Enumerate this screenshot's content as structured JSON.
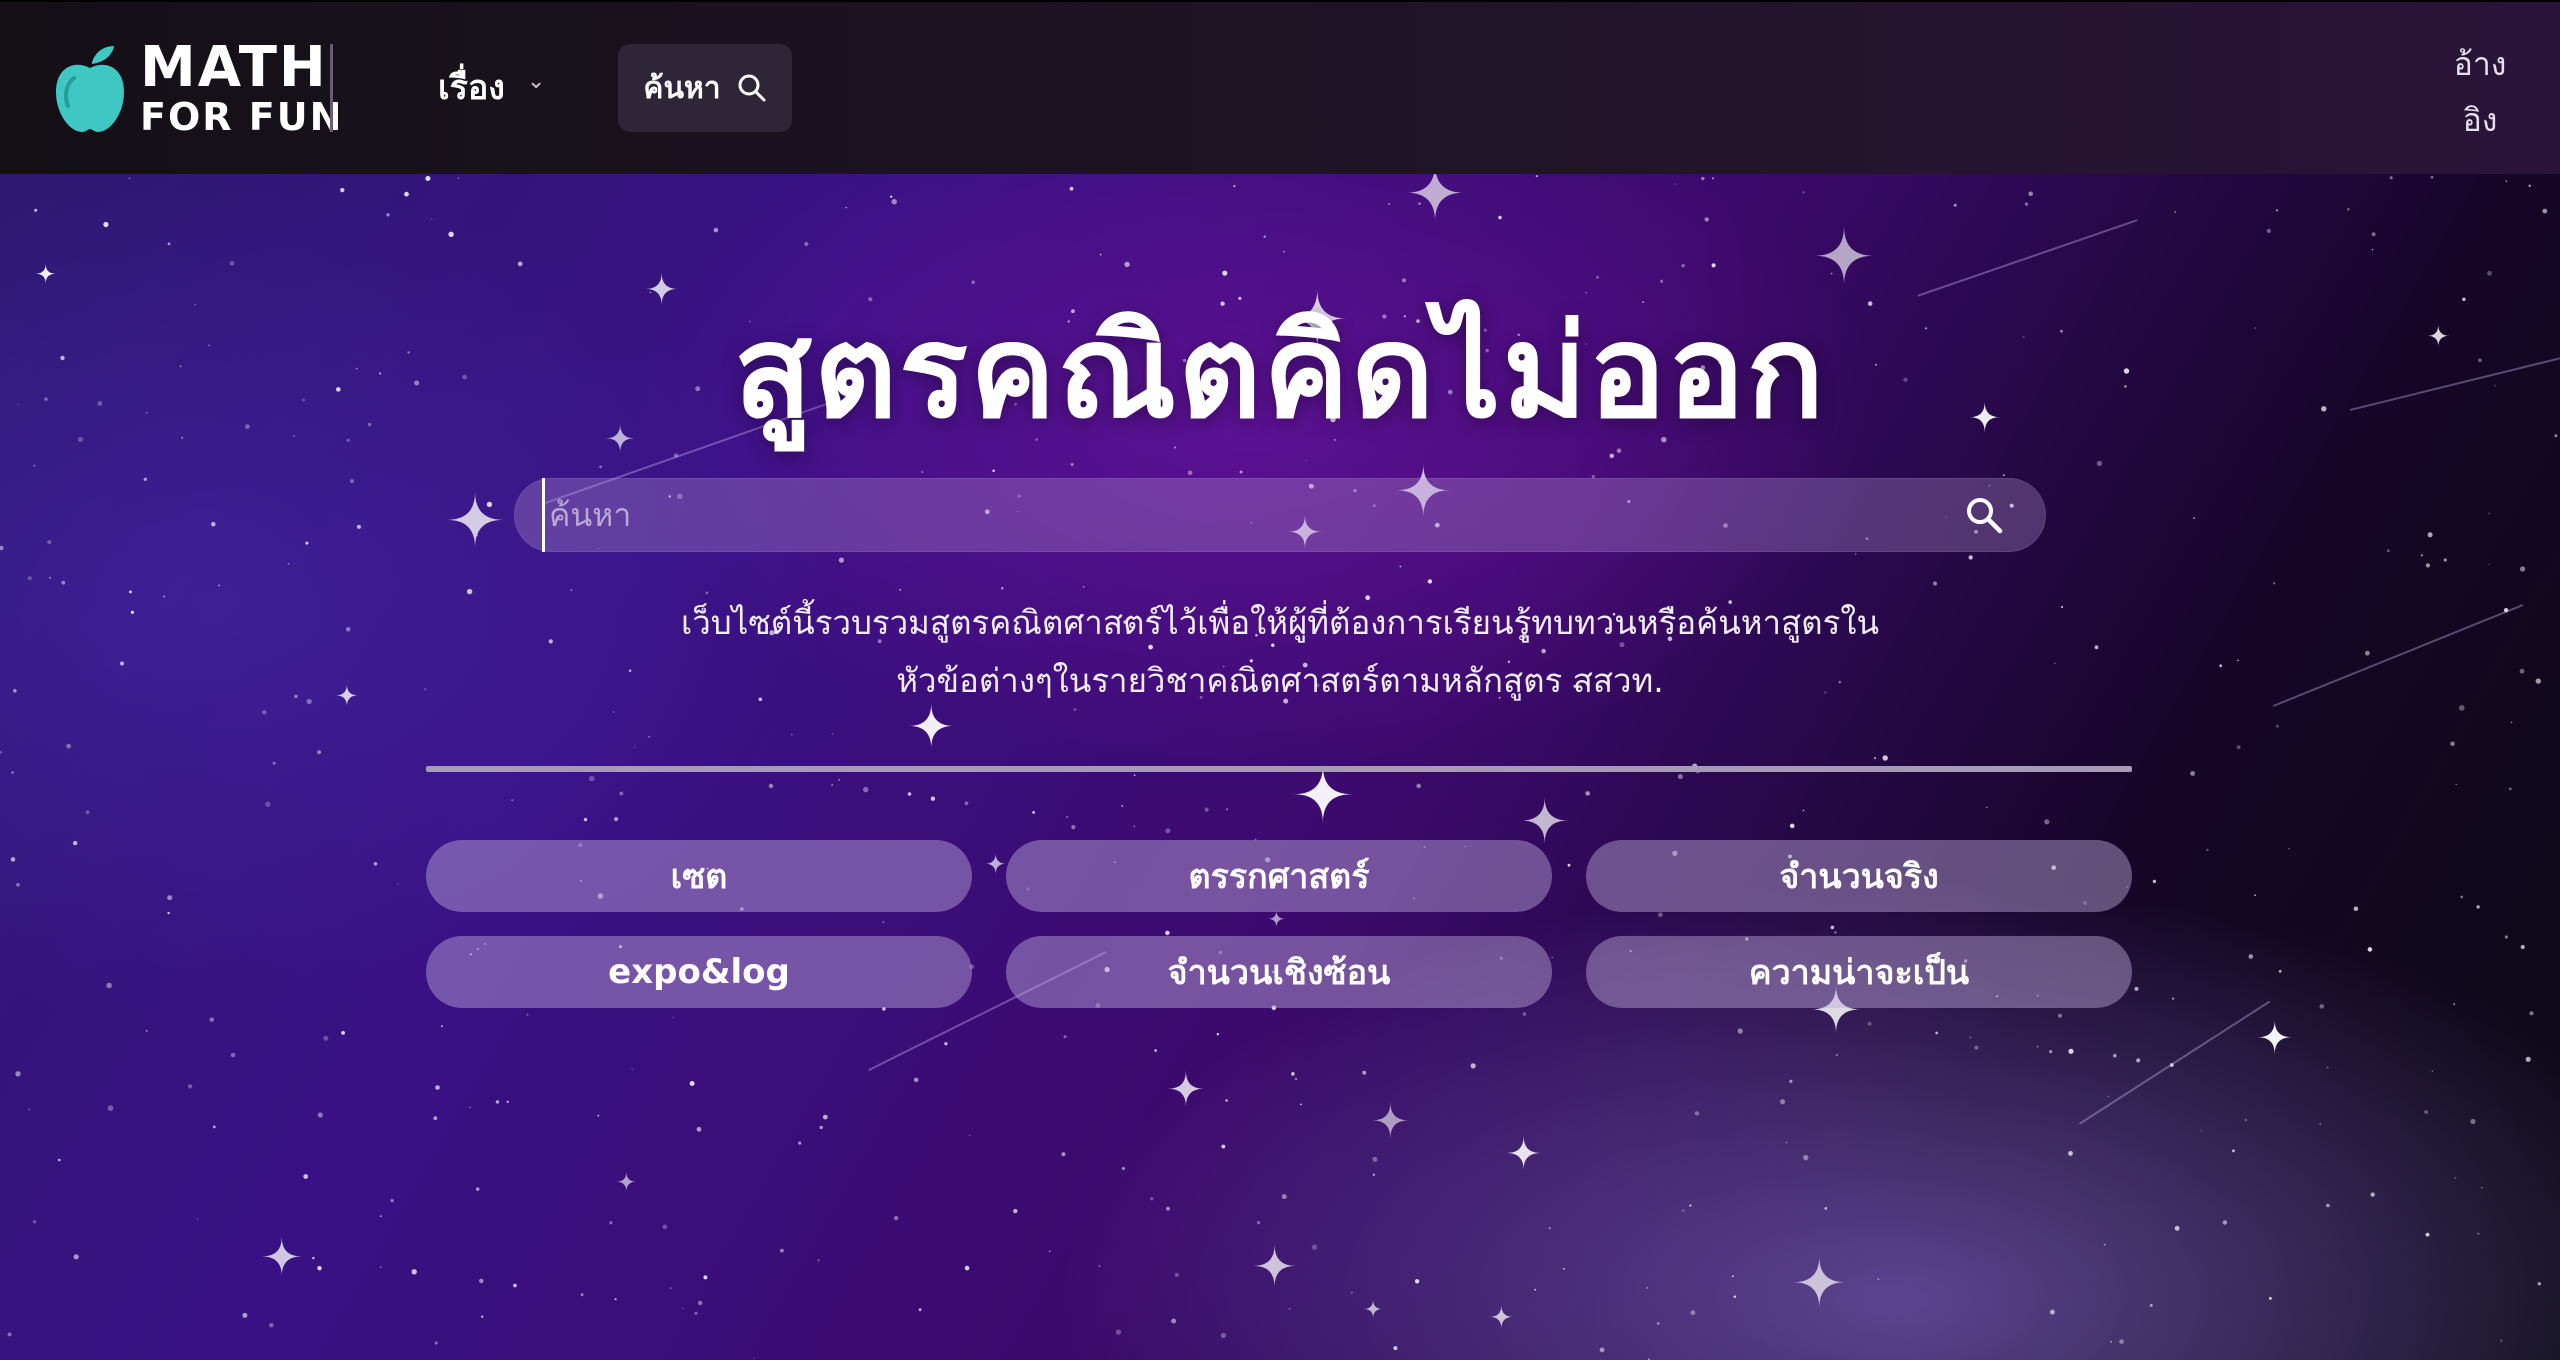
{
  "header": {
    "logo": {
      "line1": "MATH",
      "line2": "FOR FUN"
    },
    "nav_topics_label": "เรื่อง",
    "nav_search_label": "ค้นหา",
    "reference_line1": "อ้าง",
    "reference_line2": "อิง"
  },
  "hero": {
    "title": "สูตรคณิตคิดไม่ออก",
    "search_placeholder": "ค้นหา",
    "search_value": "",
    "description_line1": "เว็บไซต์นี้รวบรวมสูตรคณิตศาสตร์ไว้เพื่อให้ผู้ที่ต้องการเรียนรู้ทบทวนหรือค้นหาสูตรใน",
    "description_line2": "หัวข้อต่างๆในรายวิชาคณิตศาสตร์ตามหลักสูตร สสวท."
  },
  "topics": [
    {
      "label": "เซต"
    },
    {
      "label": "ตรรกศาสตร์"
    },
    {
      "label": "จำนวนจริง"
    },
    {
      "label": "expo&log"
    },
    {
      "label": "จำนวนเชิงซ้อน"
    },
    {
      "label": "ความน่าจะเป็น"
    }
  ],
  "colors": {
    "logo_apple": "#3fc7c4",
    "header_bg": "#1a1420",
    "topic_button_bg": "#8e7ab8",
    "divider": "#a79ab6"
  }
}
